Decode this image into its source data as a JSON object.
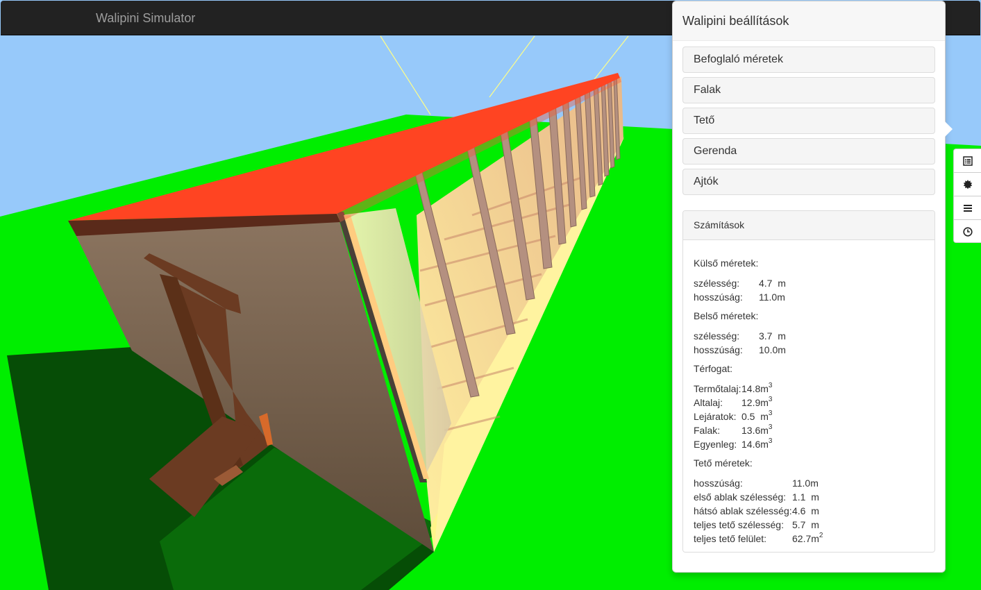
{
  "app": {
    "brand": "Walipini Simulator"
  },
  "panel": {
    "title": "Walipini beállítások",
    "sections": [
      "Befoglaló méretek",
      "Falak",
      "Tető",
      "Gerenda",
      "Ajtók"
    ]
  },
  "calc": {
    "heading": "Számítások",
    "outer": {
      "title": "Külső méretek:",
      "rows": [
        {
          "label": "szélesség:",
          "value": "4.7  m"
        },
        {
          "label": "hosszúság:",
          "value": "11.0m"
        }
      ]
    },
    "inner": {
      "title": "Belső méretek:",
      "rows": [
        {
          "label": "szélesség:",
          "value": "3.7  m"
        },
        {
          "label": "hosszúság:",
          "value": "10.0m"
        }
      ]
    },
    "volume": {
      "title": "Térfogat:",
      "rows": [
        {
          "label": "Termőtalaj:",
          "value": "14.8m",
          "sup": "3"
        },
        {
          "label": "Altalaj:",
          "value": "12.9m",
          "sup": "3"
        },
        {
          "label": "Lejáratok:",
          "value": "0.5  m",
          "sup": "3"
        },
        {
          "label": "Falak:",
          "value": "13.6m",
          "sup": "3"
        },
        {
          "label": "Egyenleg:",
          "value": "14.6m",
          "sup": "3"
        }
      ]
    },
    "roof": {
      "title": "Tető méretek:",
      "rows": [
        {
          "label": "hosszúság:",
          "value": "11.0m"
        },
        {
          "label": "első ablak szélesség:",
          "value": "1.1  m"
        },
        {
          "label": "hátsó ablak szélesség:",
          "value": "4.6  m"
        },
        {
          "label": "teljes tető szélesség:",
          "value": "5.7  m"
        },
        {
          "label": "teljes tető felület:",
          "value": "62.7m",
          "sup": "2"
        }
      ]
    }
  },
  "tools": [
    "list-alt-icon",
    "certificate-icon",
    "menu-icon",
    "clock-icon"
  ],
  "colors": {
    "sky": "#97c9fa",
    "grass": "#00ee00",
    "roof": "#ff4422",
    "navbar": "#222222"
  }
}
